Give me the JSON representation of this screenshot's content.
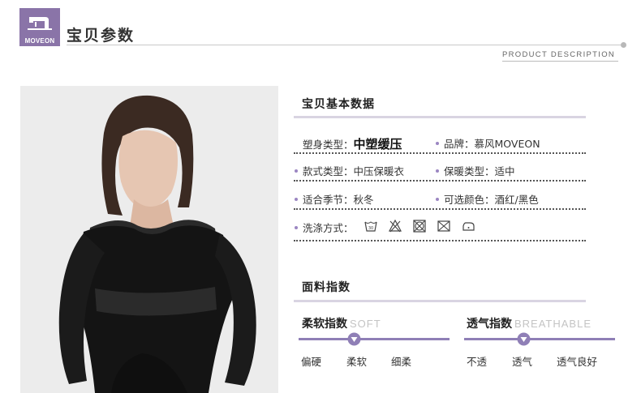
{
  "header": {
    "brand": "MOVEON",
    "title": "宝贝参数",
    "subtitle": "PRODUCT DESCRIPTION"
  },
  "basic": {
    "title": "宝贝基本数据",
    "rows": [
      [
        {
          "label": "塑身类型：",
          "value": "中塑缓压",
          "emphasis": true,
          "bullet": false
        },
        {
          "label": "品牌：",
          "value": "慕风MOVEON",
          "bullet": true
        }
      ],
      [
        {
          "label": "款式类型：",
          "value": "中压保暖衣",
          "bullet": true
        },
        {
          "label": "保暖类型：",
          "value": "适中",
          "bullet": true
        }
      ],
      [
        {
          "label": "适合季节：",
          "value": "秋冬",
          "bullet": true
        },
        {
          "label": "可选颜色：",
          "value": "酒红/黑色",
          "bullet": true
        }
      ],
      [
        {
          "label": "洗涤方式：",
          "value": "",
          "bullet": true
        }
      ]
    ],
    "care_icons": [
      "wash-30-icon",
      "no-bleach-icon",
      "no-tumble-dry-icon",
      "no-dry-clean-icon",
      "iron-low-icon"
    ]
  },
  "fabric": {
    "title": "面料指数",
    "softness": {
      "title": "柔软指数",
      "title_en": "SOFT",
      "labels": [
        "偏硬",
        "柔软",
        "细柔"
      ],
      "selected_index": 1
    },
    "breathability": {
      "title": "透气指数",
      "title_en": "BREATHABLE",
      "labels": [
        "不透",
        "透气",
        "透气良好"
      ],
      "selected_index": 1
    }
  },
  "colors": {
    "accent": "#8f7fb6",
    "brand_purple": "#8a74a8",
    "photo_bg": "#ececec"
  }
}
